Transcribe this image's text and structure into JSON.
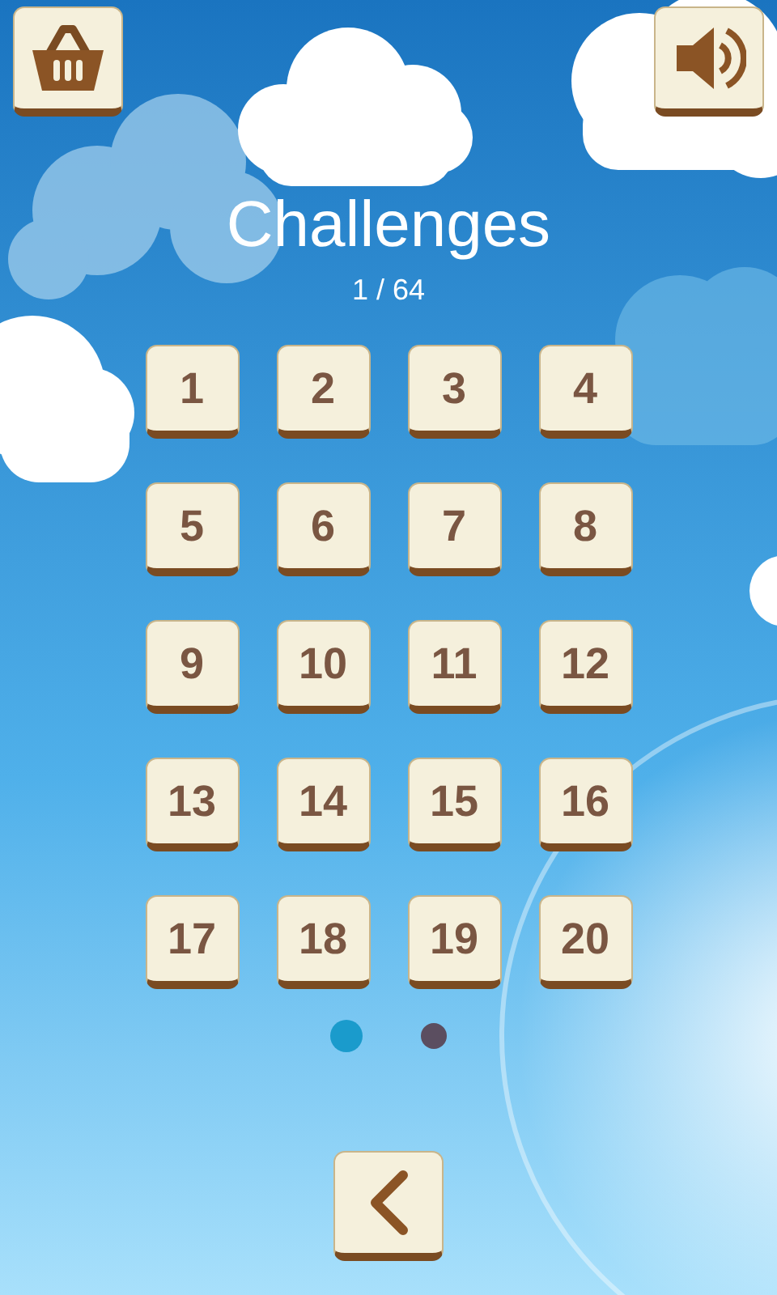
{
  "title": "Challenges",
  "progress": "1 / 64",
  "levels": [
    "1",
    "2",
    "3",
    "4",
    "5",
    "6",
    "7",
    "8",
    "9",
    "10",
    "11",
    "12",
    "13",
    "14",
    "15",
    "16",
    "17",
    "18",
    "19",
    "20"
  ],
  "pages": [
    {
      "selected": true
    },
    {
      "selected": false
    }
  ]
}
